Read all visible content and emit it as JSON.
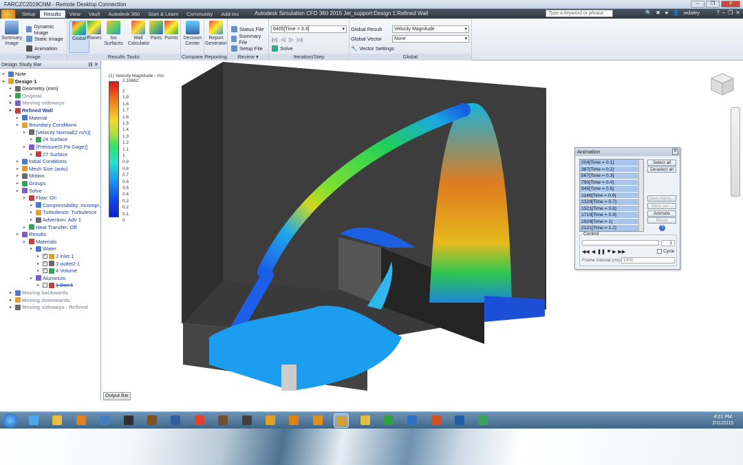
{
  "rdp": {
    "title": "FARCZC2019CNM - Remote Desktop Connection"
  },
  "app": {
    "title": "Autodesk Simulation CFD 360 2015   Jet_support:Design 1:Refined Wall",
    "tabs": [
      "Setup",
      "Results",
      "View",
      "Vault",
      "Autodesk 360",
      "Start & Learn",
      "Community",
      "Add-Ins"
    ],
    "search_placeholder": "Type a keyword or phrase",
    "user": "wdaley"
  },
  "ribbon": {
    "image_group": {
      "label": "Image",
      "summary": "Summary Image",
      "dynamic": "Dynamic Image",
      "static": "Static Image",
      "animation": "Animation"
    },
    "results_tasks": {
      "label": "Results Tasks",
      "global": "Global",
      "planes": "Planes",
      "iso": "Iso Surfaces",
      "wall": "Wall Calculator",
      "parts": "Parts",
      "points": "Points"
    },
    "compare": {
      "label": "Compare",
      "decision": "Decision Center"
    },
    "reporting": {
      "label": "Reporting",
      "report": "Report Generator"
    },
    "review": {
      "label": "Review",
      "status": "Status File",
      "summary": "Summary File",
      "setup": "Setup File"
    },
    "iteration": {
      "label": "Iteration/Step",
      "combo": "6405[Time = 3.4]",
      "solve": "Solve"
    },
    "global": {
      "label": "Global",
      "result_label": "Global Result",
      "result_value": "Velocity Magnitude",
      "vector_label": "Global Vector",
      "vector_value": "None",
      "vector_settings": "Vector Settings"
    }
  },
  "study_bar": {
    "title": "Design Study Bar",
    "items": [
      {
        "text": "Note",
        "indent": 0,
        "style": "blk"
      },
      {
        "text": "Design 1",
        "indent": 0,
        "style": "blk bold"
      },
      {
        "text": "Geometry (mm)",
        "indent": 1,
        "style": "blk"
      },
      {
        "text": "Original",
        "indent": 1,
        "style": "gray bold"
      },
      {
        "text": "Moving sideways",
        "indent": 1,
        "style": "gray bold"
      },
      {
        "text": "Refined Wall",
        "indent": 1,
        "style": "bold"
      },
      {
        "text": "Material",
        "indent": 2,
        "style": ""
      },
      {
        "text": "Boundary Conditions",
        "indent": 2,
        "style": ""
      },
      {
        "text": "[Velocity Normal(2 m/s)]",
        "indent": 3,
        "style": ""
      },
      {
        "text": "24 Surface",
        "indent": 4,
        "style": ""
      },
      {
        "text": "[Pressure(0 Pa Gage)]",
        "indent": 3,
        "style": ""
      },
      {
        "text": "27 Surface",
        "indent": 4,
        "style": ""
      },
      {
        "text": "Initial Conditions",
        "indent": 2,
        "style": ""
      },
      {
        "text": "Mesh Size (auto)",
        "indent": 2,
        "style": ""
      },
      {
        "text": "Motion",
        "indent": 2,
        "style": ""
      },
      {
        "text": "Groups",
        "indent": 2,
        "style": ""
      },
      {
        "text": "Solve",
        "indent": 2,
        "style": ""
      },
      {
        "text": "Flow: On",
        "indent": 3,
        "style": ""
      },
      {
        "text": "Compressibility: Incompr...",
        "indent": 4,
        "style": ""
      },
      {
        "text": "Turbulence: Turbulence",
        "indent": 4,
        "style": ""
      },
      {
        "text": "Advection: Adv 1",
        "indent": 4,
        "style": ""
      },
      {
        "text": "Heat Transfer: Off",
        "indent": 3,
        "style": ""
      },
      {
        "text": "Results",
        "indent": 2,
        "style": ""
      },
      {
        "text": "Materials",
        "indent": 3,
        "style": ""
      },
      {
        "text": "Water",
        "indent": 4,
        "style": ""
      },
      {
        "text": "2 inlet:1",
        "indent": 5,
        "style": "",
        "check": "✓"
      },
      {
        "text": "3 outlet2:1",
        "indent": 5,
        "style": "",
        "check": "✓"
      },
      {
        "text": "4 Volume",
        "indent": 5,
        "style": "",
        "check": "✓"
      },
      {
        "text": "Aluminum",
        "indent": 4,
        "style": ""
      },
      {
        "text": "1 Box:1",
        "indent": 5,
        "style": "strike",
        "check": " "
      },
      {
        "text": "Moving backwards",
        "indent": 1,
        "style": "gray bold"
      },
      {
        "text": "Moving downwards",
        "indent": 1,
        "style": "gray bold"
      },
      {
        "text": "Moving sideways - Refined",
        "indent": 1,
        "style": "gray bold"
      }
    ]
  },
  "legend": {
    "title": "(1) Velocity Magnitude - m/s",
    "max": "2.18862",
    "ticks": [
      "2",
      "1.9",
      "1.8",
      "1.7",
      "1.6",
      "1.5",
      "1.4",
      "1.3",
      "1.2",
      "1.1",
      "1",
      "0.9",
      "0.8",
      "0.7",
      "0.6",
      "0.5",
      "0.4",
      "0.3",
      "0.2",
      "0.1",
      "0"
    ]
  },
  "animation": {
    "title": "Animation",
    "steps": [
      "204[Time = 0.1]",
      "387[Time = 0.2]",
      "567[Time = 0.3]",
      "750[Time = 0.4]",
      "945[Time = 0.5]",
      "1146[Time = 0.6]",
      "1329[Time = 0.7]",
      "1521[Time = 0.8]",
      "1719[Time = 0.9]",
      "1929[Time = 1]",
      "2121[Time = 1.1]"
    ],
    "select_all": "Select all",
    "deselect_all": "Deselect all",
    "save_mpeg": "Save mpeg...",
    "save_avi": "Save avi...",
    "animate": "Animate",
    "reset": "Reset",
    "control": "Control",
    "step_value": "1",
    "cycle": "Cycle",
    "frame_interval_label": "Frame interval (ms)",
    "frame_interval": "1000"
  },
  "output_bar": "Output Bar",
  "clock": {
    "time": "4:21 PM",
    "date": "2/11/2015"
  },
  "colors": {
    "ribbon": "#e1e7ef",
    "tree_link": "#1a3c9e",
    "taskbar": "#3f6688",
    "solid": "#2e2e2e",
    "floor": "#3a3a3a"
  }
}
